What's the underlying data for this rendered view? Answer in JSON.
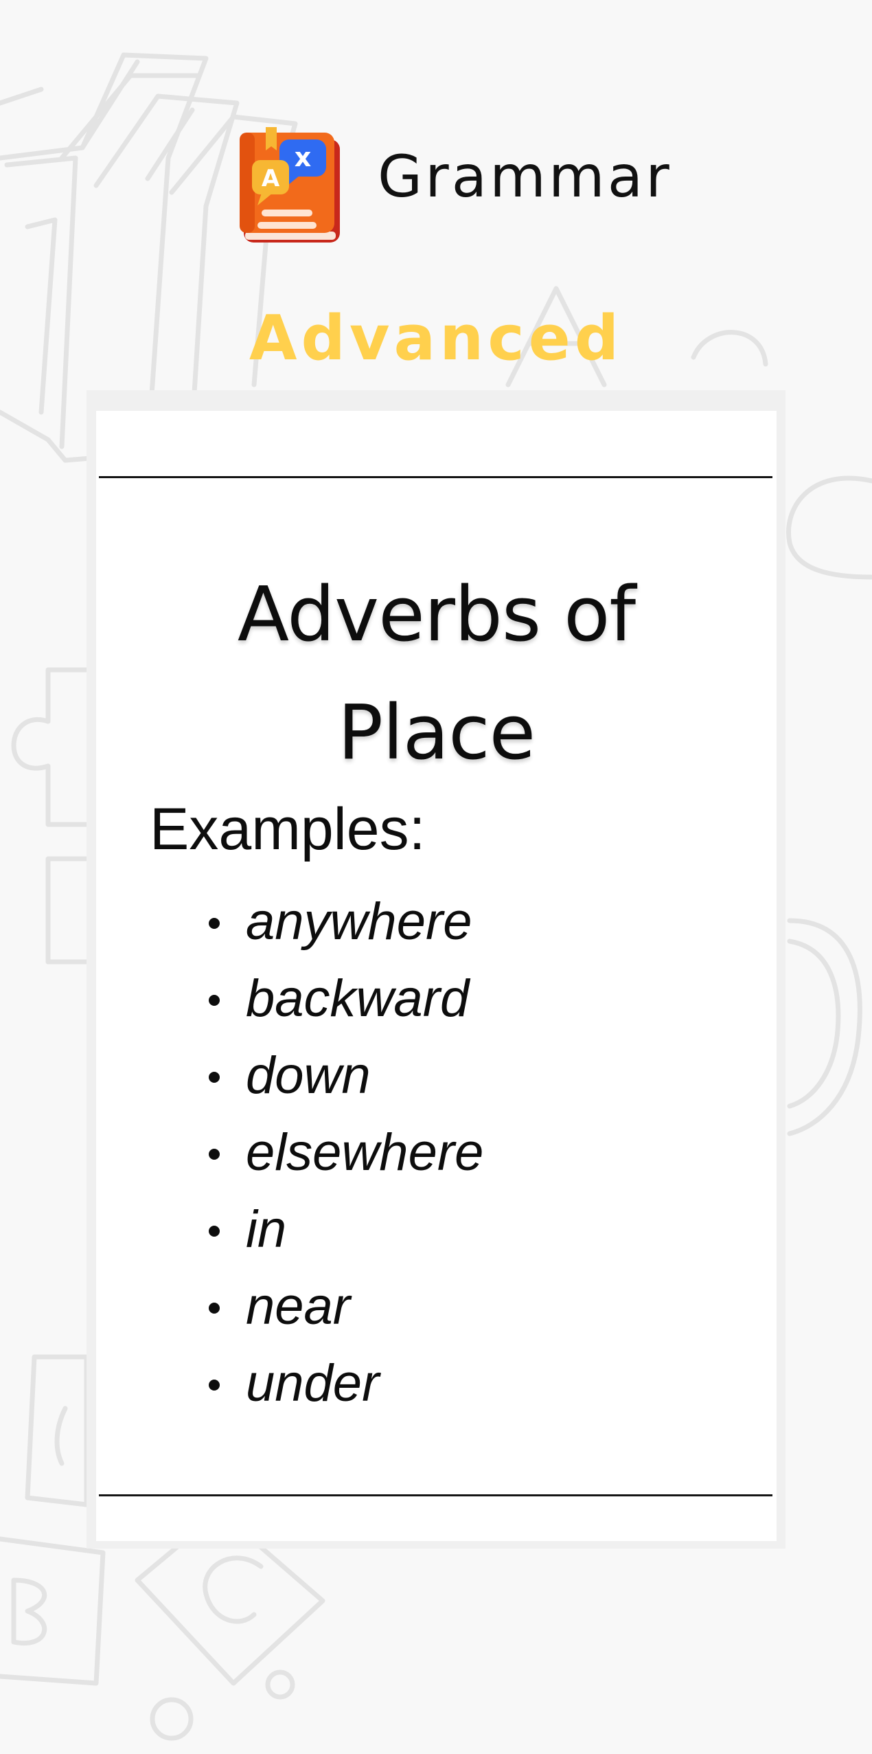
{
  "header": {
    "title": "Grammar",
    "icon": "grammar-book-icon"
  },
  "level": {
    "label": "Advanced",
    "color": "#ffd04d"
  },
  "card": {
    "title_line1": "Adverbs of",
    "title_line2": "Place",
    "examples_label": "Examples:",
    "examples": [
      "anywhere",
      "backward",
      "down",
      "elsewhere",
      "in",
      "near",
      "under"
    ]
  },
  "colors": {
    "background": "#f8f8f8",
    "card": "#ffffff",
    "decoration": "#e2e2e2",
    "book_orange": "#f26a1b",
    "bubble_blue": "#2f6bf2",
    "bubble_yellow": "#f7b733"
  }
}
